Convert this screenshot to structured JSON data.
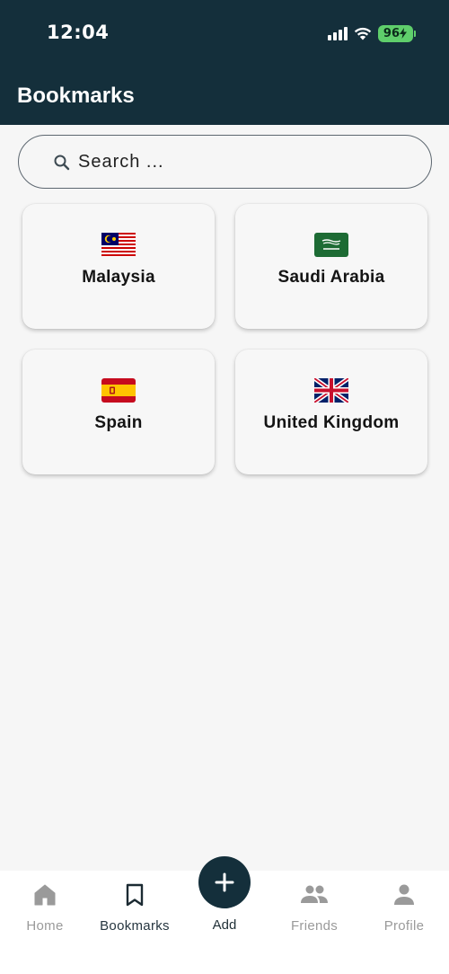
{
  "status_bar": {
    "time": "12:04",
    "battery": "96"
  },
  "header": {
    "title": "Bookmarks"
  },
  "search": {
    "placeholder": "Search ..."
  },
  "bookmarks": [
    {
      "label": "Malaysia",
      "flag_icon": "malaysia-flag-icon"
    },
    {
      "label": "Saudi Arabia",
      "flag_icon": "saudi-arabia-flag-icon"
    },
    {
      "label": "Spain",
      "flag_icon": "spain-flag-icon"
    },
    {
      "label": "United Kingdom",
      "flag_icon": "united-kingdom-flag-icon"
    }
  ],
  "nav": {
    "home": "Home",
    "bookmarks": "Bookmarks",
    "add": "Add",
    "friends": "Friends",
    "profile": "Profile"
  },
  "colors": {
    "primary": "#142f3b",
    "background": "#f6f6f6",
    "inactive": "#9a9a9a",
    "battery": "#5fce6b"
  }
}
